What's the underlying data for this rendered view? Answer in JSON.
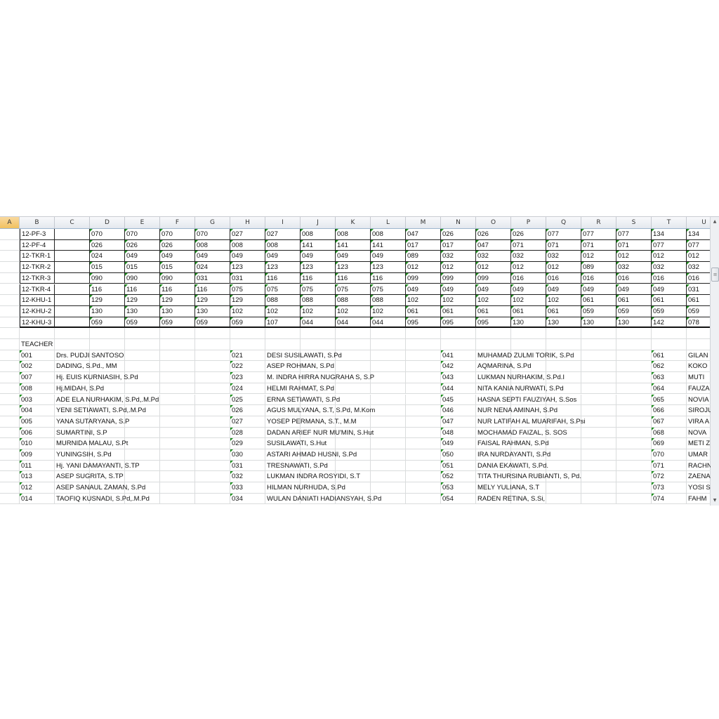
{
  "columns": [
    "A",
    "B",
    "C",
    "D",
    "E",
    "F",
    "G",
    "H",
    "I",
    "J",
    "K",
    "L",
    "M",
    "N",
    "O",
    "P",
    "Q",
    "R",
    "S",
    "T",
    "U"
  ],
  "schedule": [
    {
      "cls": "12-PF-3",
      "v": [
        "070",
        "070",
        "070",
        "070",
        "027",
        "027",
        "008",
        "008",
        "008",
        "047",
        "026",
        "026",
        "026",
        "077",
        "077",
        "077",
        "134",
        "134"
      ]
    },
    {
      "cls": "12-PF-4",
      "v": [
        "026",
        "026",
        "026",
        "008",
        "008",
        "008",
        "141",
        "141",
        "141",
        "017",
        "017",
        "047",
        "071",
        "071",
        "071",
        "071",
        "077",
        "077"
      ]
    },
    {
      "cls": "12-TKR-1",
      "v": [
        "024",
        "049",
        "049",
        "049",
        "049",
        "049",
        "049",
        "049",
        "049",
        "089",
        "032",
        "032",
        "032",
        "032",
        "012",
        "012",
        "012",
        "012"
      ]
    },
    {
      "cls": "12-TKR-2",
      "v": [
        "015",
        "015",
        "015",
        "024",
        "123",
        "123",
        "123",
        "123",
        "123",
        "012",
        "012",
        "012",
        "012",
        "012",
        "089",
        "032",
        "032",
        "032"
      ]
    },
    {
      "cls": "12-TKR-3",
      "v": [
        "090",
        "090",
        "090",
        "031",
        "031",
        "116",
        "116",
        "116",
        "116",
        "099",
        "099",
        "099",
        "016",
        "016",
        "016",
        "016",
        "016",
        "016"
      ]
    },
    {
      "cls": "12-TKR-4",
      "v": [
        "116",
        "116",
        "116",
        "116",
        "075",
        "075",
        "075",
        "075",
        "075",
        "049",
        "049",
        "049",
        "049",
        "049",
        "049",
        "049",
        "049",
        "031"
      ]
    },
    {
      "cls": "12-KHU-1",
      "v": [
        "129",
        "129",
        "129",
        "129",
        "129",
        "088",
        "088",
        "088",
        "088",
        "102",
        "102",
        "102",
        "102",
        "102",
        "061",
        "061",
        "061",
        "061"
      ]
    },
    {
      "cls": "12-KHU-2",
      "v": [
        "130",
        "130",
        "130",
        "130",
        "102",
        "102",
        "102",
        "102",
        "102",
        "061",
        "061",
        "061",
        "061",
        "061",
        "059",
        "059",
        "059",
        "059"
      ]
    },
    {
      "cls": "12-KHU-3",
      "v": [
        "059",
        "059",
        "059",
        "059",
        "059",
        "107",
        "044",
        "044",
        "044",
        "095",
        "095",
        "095",
        "130",
        "130",
        "130",
        "130",
        "142",
        "078"
      ]
    }
  ],
  "teacher_label": "TEACHER",
  "teachers": [
    [
      [
        "001",
        "Drs. PUDJI SANTOSO"
      ],
      [
        "002",
        "DADING, S.Pd., MM"
      ],
      [
        "007",
        "Hj. EUIS KURNIASIH, S.Pd"
      ],
      [
        "008",
        "Hj.MIDAH, S.Pd"
      ],
      [
        "003",
        "ADE ELA NURHAKIM, S.Pd,.M.Pd"
      ],
      [
        "004",
        "YENI SETIAWATI, S.Pd,.M.Pd"
      ],
      [
        "005",
        "YANA SUTARYANA, S.P"
      ],
      [
        "006",
        "SUMARTINI, S.P"
      ],
      [
        "010",
        "MURNIDA MALAU, S.Pt"
      ],
      [
        "009",
        "YUNINGSIH, S.Pd"
      ],
      [
        "011",
        "Hj. YANI DAMAYANTI, S.TP"
      ],
      [
        "013",
        "ASEP SUGRITA, S.TP"
      ],
      [
        "012",
        "ASEP SANAUL ZAMAN, S.Pd"
      ],
      [
        "014",
        "TAOFIQ KUSNADI, S.Pd,.M.Pd"
      ]
    ],
    [
      [
        "021",
        "DESI SUSILAWATI, S.Pd"
      ],
      [
        "022",
        "ASEP ROHMAN, S.Pd"
      ],
      [
        "023",
        "M. INDRA HIRRA NUGRAHA S, S.P"
      ],
      [
        "024",
        "HELMI RAHMAT, S.Pd"
      ],
      [
        "025",
        "ERNA SETIAWATI, S.Pd"
      ],
      [
        "026",
        "AGUS MULYANA, S.T, S.Pd, M.Kom"
      ],
      [
        "027",
        "YOSEP PERMANA, S.T., M.M"
      ],
      [
        "028",
        "DADAN ARIEF NUR MU'MIN, S.Hut"
      ],
      [
        "029",
        "SUSILAWATI, S.Hut"
      ],
      [
        "030",
        "ASTARI AHMAD HUSNI, S.Pd"
      ],
      [
        "031",
        "TRESNAWATI, S.Pd"
      ],
      [
        "032",
        "LUKMAN INDRA ROSYIDI, S.T"
      ],
      [
        "033",
        "HILMAN NURHUDA, S.Pd"
      ],
      [
        "034",
        "WULAN DANIATI HADIANSYAH, S.Pd"
      ]
    ],
    [
      [
        "041",
        "MUHAMAD ZULMI TORIK, S.Pd"
      ],
      [
        "042",
        "AQMARINA, S.Pd"
      ],
      [
        "043",
        "LUKMAN NURHAKIM, S.Pd.I"
      ],
      [
        "044",
        "NITA KANIA NURWATI, S.Pd"
      ],
      [
        "045",
        "HASNA SEPTI FAUZIYAH, S.Sos"
      ],
      [
        "046",
        "NUR NENA AMINAH, S.Pd"
      ],
      [
        "047",
        "NUR LATIFAH AL MUARIFAH, S.Psi"
      ],
      [
        "048",
        "MOCHAMAD FAIZAL, S. SOS"
      ],
      [
        "049",
        "FAISAL RAHMAN, S.Pd"
      ],
      [
        "050",
        "IRA NURDAYANTI, S.Pd"
      ],
      [
        "051",
        "DANIA EKAWATI, S.Pd."
      ],
      [
        "052",
        "TITA THURSINA RUBIANTI, S, Pd."
      ],
      [
        "053",
        "MELY YULIANA, S.T"
      ],
      [
        "054",
        "RADEN RETINA, S.Si,"
      ]
    ],
    [
      [
        "061",
        "GILAN"
      ],
      [
        "062",
        "KOKO"
      ],
      [
        "063",
        "MUTI"
      ],
      [
        "064",
        "FAUZA"
      ],
      [
        "065",
        "NOVIA"
      ],
      [
        "066",
        "SIROJU"
      ],
      [
        "067",
        "VIRA A"
      ],
      [
        "068",
        "NOVA"
      ],
      [
        "069",
        "METI Z"
      ],
      [
        "070",
        "UMAR"
      ],
      [
        "071",
        "RACHN"
      ],
      [
        "072",
        "ZAENA"
      ],
      [
        "073",
        "YOSI S"
      ],
      [
        "074",
        "FAHM"
      ]
    ]
  ]
}
